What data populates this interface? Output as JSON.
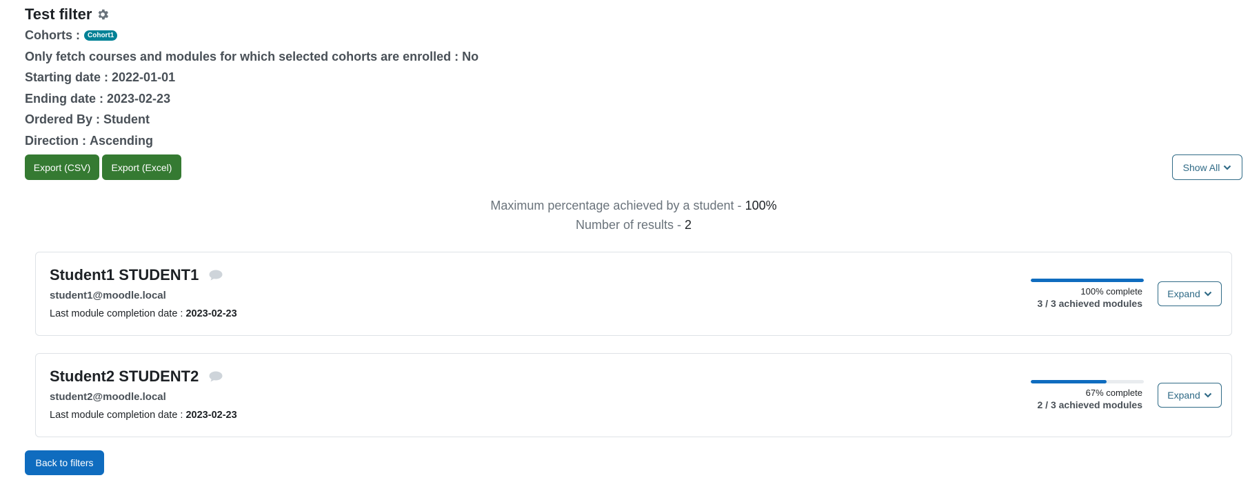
{
  "filter": {
    "title": "Test filter",
    "cohorts_label": "Cohorts :",
    "cohort_badge": "Cohort1",
    "enrolled_label": "Only fetch courses and modules for which selected cohorts are enrolled :",
    "enrolled_value": "No",
    "start_label": "Starting date :",
    "start_value": "2022-01-01",
    "end_label": "Ending date :",
    "end_value": "2023-02-23",
    "ordered_label": "Ordered By :",
    "ordered_value": "Student",
    "direction_label": "Direction :",
    "direction_value": "Ascending"
  },
  "toolbar": {
    "export_csv": "Export (CSV)",
    "export_excel": "Export (Excel)",
    "show_all": "Show All"
  },
  "summary": {
    "max_label": "Maximum percentage achieved by a student -",
    "max_value": "100%",
    "count_label": "Number of results -",
    "count_value": "2"
  },
  "students": [
    {
      "name": "Student1 STUDENT1",
      "email": "student1@moodle.local",
      "last_label": "Last module completion date :",
      "last_date": "2023-02-23",
      "progress": 1.0,
      "percent_text": "100% complete",
      "achieved_text": "3 / 3 achieved modules",
      "expand_label": "Expand"
    },
    {
      "name": "Student2 STUDENT2",
      "email": "student2@moodle.local",
      "last_label": "Last module completion date :",
      "last_date": "2023-02-23",
      "progress": 0.67,
      "percent_text": "67% complete",
      "achieved_text": "2 / 3 achieved modules",
      "expand_label": "Expand"
    }
  ],
  "footer": {
    "back_label": "Back to filters"
  },
  "icons": {
    "gear": "gear-icon",
    "comment": "comment-icon",
    "chevron": "chevron-down-icon"
  },
  "colors": {
    "primary": "#0f6cbf",
    "success": "#357a32",
    "badge": "#008196"
  }
}
